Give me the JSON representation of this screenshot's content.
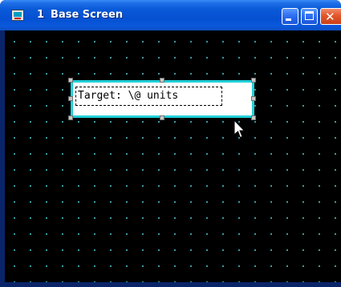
{
  "window": {
    "number": "1",
    "title": "Base Screen"
  },
  "text_object": {
    "text": "Target: \\@ units"
  },
  "icons": {
    "app": "screen-icon",
    "minimize": "minimize-icon",
    "maximize": "maximize-icon",
    "close": "close-icon",
    "cursor": "mouse-pointer-icon"
  },
  "colors": {
    "titlebar": "#0550d2",
    "canvas": "#000000",
    "grid_dots": "#3cb4b4",
    "selection_border": "#20d0d8",
    "close_button": "#e4562a"
  }
}
